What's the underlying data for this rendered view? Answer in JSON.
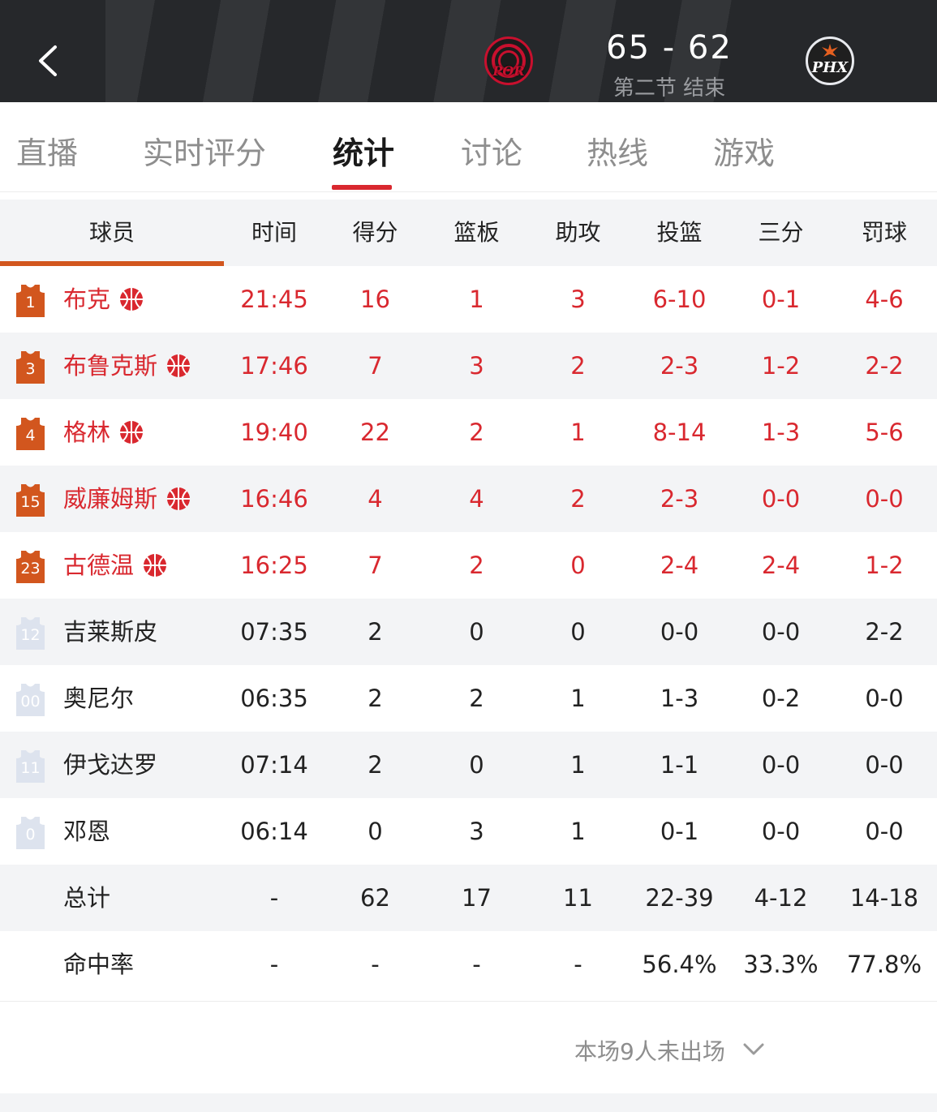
{
  "header": {
    "back_icon": "chevron-left-icon",
    "home_team_logo_text": "POR",
    "away_team_logo_text": "PHX",
    "score": "65 - 62",
    "period": "第二节 结束"
  },
  "tabs": [
    {
      "label": "直播",
      "active": false
    },
    {
      "label": "实时评分",
      "active": false
    },
    {
      "label": "统计",
      "active": true
    },
    {
      "label": "讨论",
      "active": false
    },
    {
      "label": "热线",
      "active": false
    },
    {
      "label": "游戏",
      "active": false
    }
  ],
  "columns": [
    "球员",
    "时间",
    "得分",
    "篮板",
    "助攻",
    "投篮",
    "三分",
    "罚球"
  ],
  "colors": {
    "starter_text": "#d9282f",
    "starter_jersey": "#d2561e",
    "bench_jersey": "#dde3ee",
    "header_bg": "#26282b",
    "tab_active_underline": "#d9282f"
  },
  "starters": [
    {
      "number": "1",
      "name": "布克",
      "time": "21:45",
      "pts": "16",
      "reb": "1",
      "ast": "3",
      "fg": "6-10",
      "three": "0-1",
      "ft": "4-6"
    },
    {
      "number": "3",
      "name": "布鲁克斯",
      "time": "17:46",
      "pts": "7",
      "reb": "3",
      "ast": "2",
      "fg": "2-3",
      "three": "1-2",
      "ft": "2-2"
    },
    {
      "number": "4",
      "name": "格林",
      "time": "19:40",
      "pts": "22",
      "reb": "2",
      "ast": "1",
      "fg": "8-14",
      "three": "1-3",
      "ft": "5-6"
    },
    {
      "number": "15",
      "name": "威廉姆斯",
      "time": "16:46",
      "pts": "4",
      "reb": "4",
      "ast": "2",
      "fg": "2-3",
      "three": "0-0",
      "ft": "0-0"
    },
    {
      "number": "23",
      "name": "古德温",
      "time": "16:25",
      "pts": "7",
      "reb": "2",
      "ast": "0",
      "fg": "2-4",
      "three": "2-4",
      "ft": "1-2"
    }
  ],
  "bench": [
    {
      "number": "12",
      "name": "吉莱斯皮",
      "time": "07:35",
      "pts": "2",
      "reb": "0",
      "ast": "0",
      "fg": "0-0",
      "three": "0-0",
      "ft": "2-2"
    },
    {
      "number": "00",
      "name": "奥尼尔",
      "time": "06:35",
      "pts": "2",
      "reb": "2",
      "ast": "1",
      "fg": "1-3",
      "three": "0-2",
      "ft": "0-0"
    },
    {
      "number": "11",
      "name": "伊戈达罗",
      "time": "07:14",
      "pts": "2",
      "reb": "0",
      "ast": "1",
      "fg": "1-1",
      "three": "0-0",
      "ft": "0-0"
    },
    {
      "number": "0",
      "name": "邓恩",
      "time": "06:14",
      "pts": "0",
      "reb": "3",
      "ast": "1",
      "fg": "0-1",
      "three": "0-0",
      "ft": "0-0"
    }
  ],
  "totals": {
    "label": "总计",
    "time": "-",
    "pts": "62",
    "reb": "17",
    "ast": "11",
    "fg": "22-39",
    "three": "4-12",
    "ft": "14-18"
  },
  "percentages": {
    "label": "命中率",
    "time": "-",
    "pts": "-",
    "reb": "-",
    "ast": "-",
    "fg": "56.4%",
    "three": "33.3%",
    "ft": "77.8%"
  },
  "did_not_play": {
    "label": "本场9人未出场",
    "icon": "chevron-down-icon"
  }
}
